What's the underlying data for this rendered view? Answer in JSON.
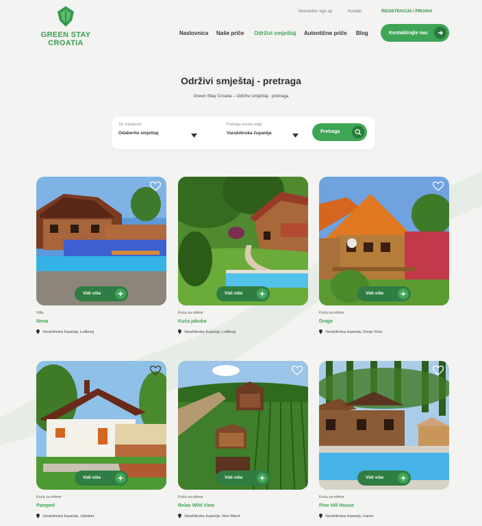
{
  "brand": {
    "line1": "GREEN STAY",
    "line2": "CROATIA"
  },
  "topbar": {
    "items": [
      "Newsletter sign up",
      "Kontakt",
      "REGISTRACIJA / PRIJAVA"
    ]
  },
  "nav": {
    "items": [
      "Naslovnica",
      "Naše priče",
      "Održivi smještaj",
      "Autentične priče",
      "Blog"
    ],
    "active_index": 2
  },
  "cta": {
    "label": "Kontaktirajte nas"
  },
  "page": {
    "title": "Održivi smještaj - pretraga",
    "breadcrumb": "Green Stay Croatia – Održivi smještaj - pretraga"
  },
  "search": {
    "type_label": "Tip vrijednosti",
    "type_value": "Odaberite smještaj",
    "region_label": "Pretraga prema regiji",
    "region_value": "Varaždinska županija",
    "button_label": "Pretraga"
  },
  "view_label": "Vidi više",
  "cards": [
    {
      "type": "Villa",
      "name": "Nena",
      "location": "Varaždinska županija, Ludbreg"
    },
    {
      "type": "Kuća za odmor",
      "name": "Kuća jabuka",
      "location": "Varaždinska županija, Ludbreg"
    },
    {
      "type": "Kuća za odmor",
      "name": "Draga",
      "location": "Varaždinska županija, Donja Voća"
    },
    {
      "type": "Kuća za odmor",
      "name": "Pampeti",
      "location": "Varaždinska županija, Jalžabet"
    },
    {
      "type": "Kuća za odmor",
      "name": "Relax Wild View",
      "location": "Varaždinska županija, Novi Marof"
    },
    {
      "type": "Kuća za odmor",
      "name": "Pine Hill House",
      "location": "Varaždinska županija, Ivanec"
    }
  ],
  "colors": {
    "brand_green": "#3fa556",
    "dark_green": "#2a7a3c",
    "background": "#f3f3f1"
  },
  "icons": [
    "logo-leaf-icon",
    "arrow-right-icon",
    "search-icon",
    "chevron-down-icon",
    "heart-icon",
    "plus-icon",
    "location-pin-icon"
  ]
}
